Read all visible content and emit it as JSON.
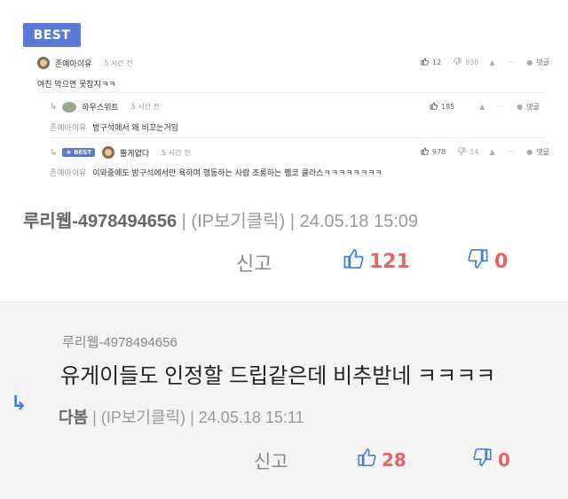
{
  "best_label": "BEST",
  "comments": [
    {
      "author": "존예아이유",
      "time": "5 시간 전",
      "text": "여친 막으면 못참지ㅋㅋ",
      "likes": "12",
      "dislikes": "838",
      "report": "▲",
      "more": "···",
      "reply": "댓글"
    },
    {
      "author": "하우스위트",
      "time": "5 시간 전",
      "mention": "존예아이유",
      "text": "방구석에서 왜 비꼬는거임",
      "likes": "185",
      "report": "▲",
      "more": "···",
      "reply": "댓글"
    },
    {
      "best_badge": "BEST",
      "author": "뿔게없다",
      "time": "5 시간 전",
      "mention": "존예아이유",
      "text": "이와중에도 방구석에서만 욕하며 행동하는 사람 조롱하는 펨코 클라스ㅋㅋㅋㅋㅋㅋㅋㅋ",
      "likes": "978",
      "dislikes": "14",
      "report": "▲",
      "more": "···",
      "reply": "댓글"
    }
  ],
  "post": {
    "author": "루리웹-4978494656",
    "ip": "(IP보기클릭)",
    "date": "24.05.18 15:09",
    "report": "신고",
    "likes": "121",
    "dislikes": "0"
  },
  "reply_post": {
    "quoted_author": "루리웹-4978494656",
    "text": "유게이들도 인정할 드립같은데 비추받네 ㅋㅋㅋㅋ",
    "author": "다봄",
    "ip": "(IP보기클릭)",
    "date": "24.05.18 15:11",
    "report": "신고",
    "likes": "28",
    "dislikes": "0"
  },
  "colors": {
    "best_badge": "#5b79d6",
    "like_accent": "#e06666",
    "thumb_blue": "#3b7ed6",
    "reply_bg": "#f4f4f4"
  }
}
